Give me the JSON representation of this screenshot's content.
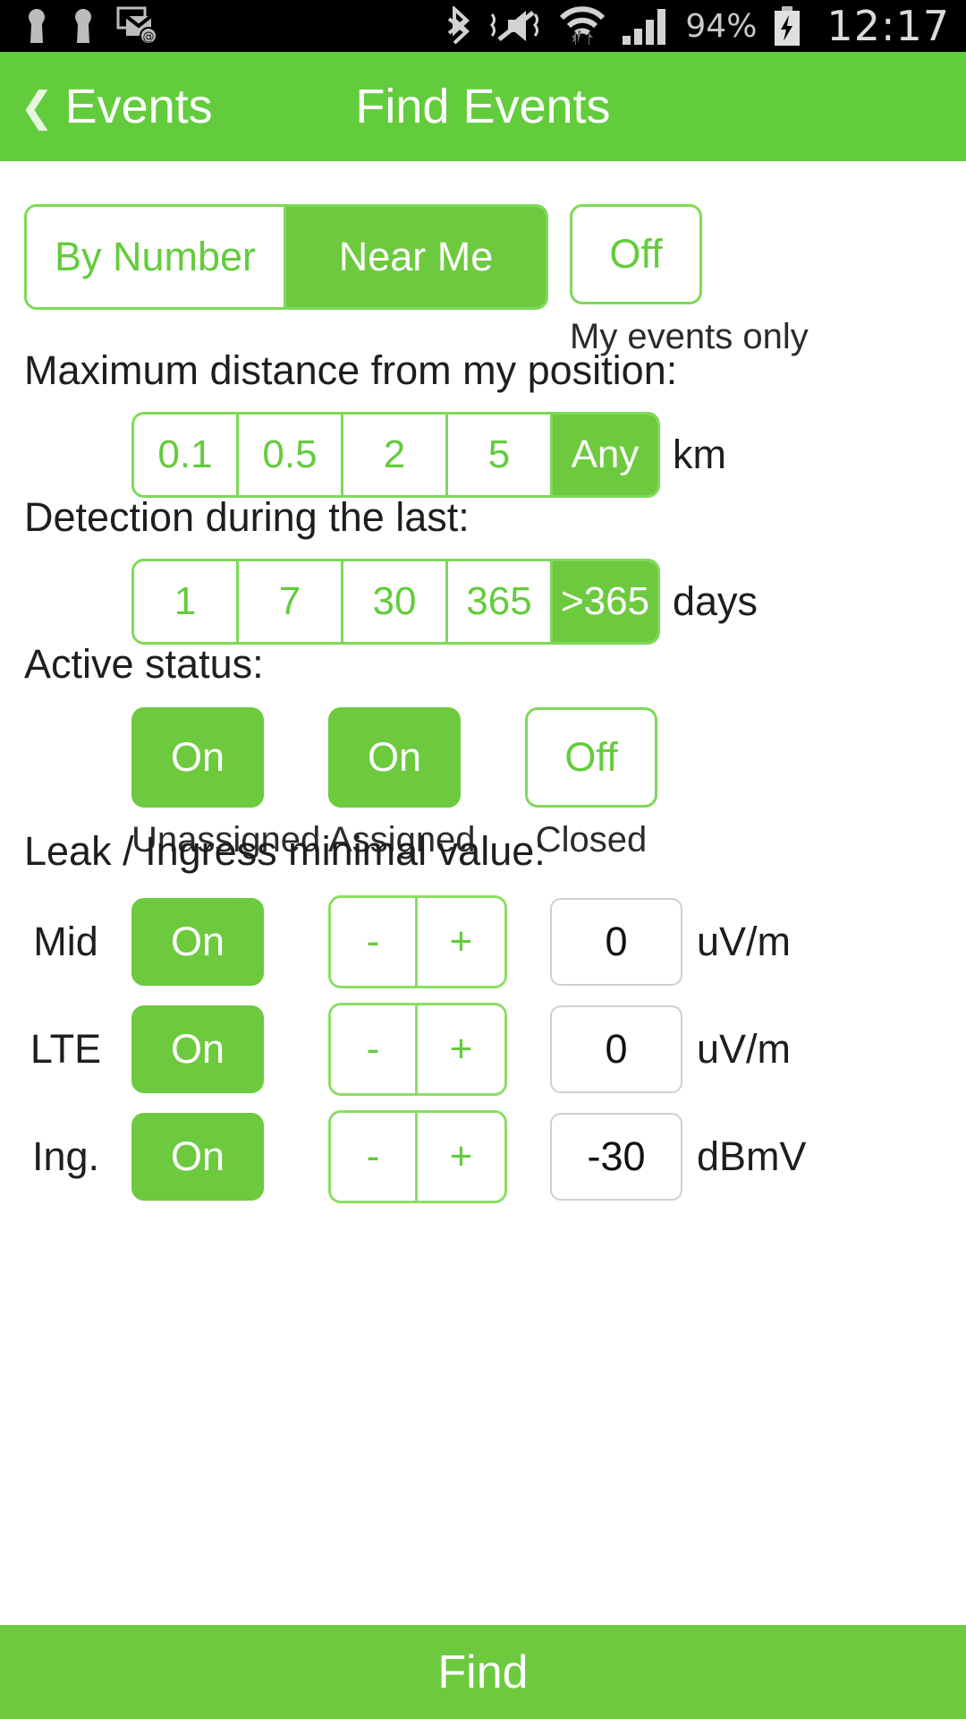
{
  "colors": {
    "brand_green": "#63cc3c",
    "segment_green": "#6dca3e",
    "border_green": "#7ed957",
    "status_bar": "#000000",
    "text_dark": "#1e1e1e",
    "white": "#ffffff"
  },
  "status_bar": {
    "left_icons": [
      "sim-card-icon",
      "sim-card-icon",
      "email-attention-icon"
    ],
    "right_icons": [
      "bluetooth-icon",
      "vibrate-mute-icon",
      "wifi-data-icon",
      "signal-bars-icon"
    ],
    "battery_percent": "94%",
    "battery_icon": "battery-charging-icon",
    "clock": "12:17"
  },
  "header": {
    "back_chevron": "chevron-left-icon",
    "back_label": "Events",
    "title": "Find Events"
  },
  "mode_selector": {
    "name": "search-mode",
    "options": [
      {
        "label": "By Number",
        "selected": false
      },
      {
        "label": "Near Me",
        "selected": true
      }
    ]
  },
  "my_events_only": {
    "button_label": "Off",
    "selected": false,
    "caption": "My events only"
  },
  "distance": {
    "label": "Maximum distance from my position:",
    "options": [
      {
        "label": "0.1",
        "selected": false
      },
      {
        "label": "0.5",
        "selected": false
      },
      {
        "label": "2",
        "selected": false
      },
      {
        "label": "5",
        "selected": false
      },
      {
        "label": "Any",
        "selected": true
      }
    ],
    "unit": "km"
  },
  "detection": {
    "label": "Detection during the last:",
    "options": [
      {
        "label": "1",
        "selected": false
      },
      {
        "label": "7",
        "selected": false
      },
      {
        "label": "30",
        "selected": false
      },
      {
        "label": "365",
        "selected": false
      },
      {
        "label": ">365",
        "selected": true
      }
    ],
    "unit": "days"
  },
  "active_status": {
    "label": "Active status:",
    "items": [
      {
        "state": "On",
        "selected": true,
        "caption": "Unassigned"
      },
      {
        "state": "On",
        "selected": true,
        "caption": "Assigned"
      },
      {
        "state": "Off",
        "selected": false,
        "caption": "Closed"
      }
    ]
  },
  "leak_ingress": {
    "label": "Leak / Ingress minimal value:",
    "minus_label": "-",
    "plus_label": "+",
    "rows": [
      {
        "name": "Mid",
        "state": "On",
        "selected": true,
        "value": "0",
        "unit": "uV/m"
      },
      {
        "name": "LTE",
        "state": "On",
        "selected": true,
        "value": "0",
        "unit": "uV/m"
      },
      {
        "name": "Ing.",
        "state": "On",
        "selected": true,
        "value": "-30",
        "unit": "dBmV"
      }
    ]
  },
  "footer": {
    "find_label": "Find"
  }
}
